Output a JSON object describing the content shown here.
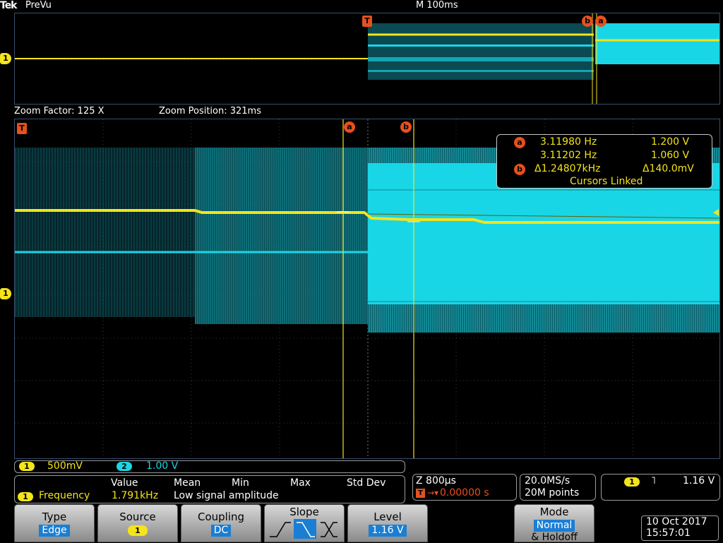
{
  "header": {
    "brand": "Tek",
    "mode": "PreVu",
    "timebase": "M 100ms"
  },
  "markers": {
    "ch1": "1",
    "trigger": "T",
    "cursor_a": "a",
    "cursor_b": "b"
  },
  "zoom": {
    "factor": "Zoom Factor: 125 X",
    "position": "Zoom Position: 321ms"
  },
  "cursor_readout": {
    "row1_freq": "3.11980 Hz",
    "row1_volt": "1.200 V",
    "row2_freq": "3.11202 Hz",
    "row2_volt": "1.060 V",
    "delta_freq": "Δ1.24807kHz",
    "delta_volt": "Δ140.0mV",
    "linked": "Cursors Linked"
  },
  "channels": [
    {
      "num": "1",
      "scale": "500mV",
      "color": "#f4e41a"
    },
    {
      "num": "2",
      "scale": "1.00 V",
      "color": "#19d6e6"
    }
  ],
  "measurement": {
    "headers": [
      "Value",
      "Mean",
      "Min",
      "Max",
      "Std Dev"
    ],
    "channel": "1",
    "name": "Frequency",
    "value": "1.791kHz",
    "note": "Low signal amplitude"
  },
  "horizontal": {
    "zoom_scale": "Z 800µs",
    "trigger_pos": "0.00000 s"
  },
  "acquisition": {
    "rate": "20.0MS/s",
    "points": "20M points"
  },
  "trigger_info": {
    "channel": "1",
    "level": "1.16 V"
  },
  "buttons": {
    "type_label": "Type",
    "type_value": "Edge",
    "source_label": "Source",
    "source_value": "1",
    "coupling_label": "Coupling",
    "coupling_value": "DC",
    "slope_label": "Slope",
    "level_label": "Level",
    "level_value": "1.16 V",
    "mode_label": "Mode",
    "mode_value": "Normal",
    "mode_sub": "& Holdoff"
  },
  "datetime": {
    "date": "10 Oct  2017",
    "time": "15:57:01"
  },
  "colors": {
    "ch1": "#f4e41a",
    "ch2": "#19d6e6",
    "cursor": "#e6501e",
    "accent": "#1a7ed4"
  }
}
